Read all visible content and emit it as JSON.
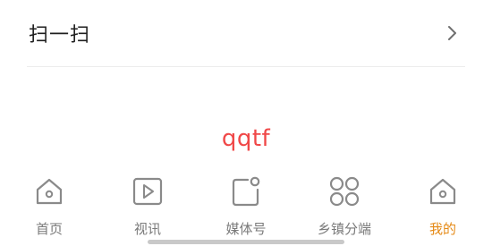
{
  "scan_row": {
    "label": "扫一扫",
    "icon": "chevron-right-icon"
  },
  "brand_text": "qqtf",
  "tabbar": {
    "tabs": [
      {
        "label": "首页",
        "icon": "home-icon",
        "active": false
      },
      {
        "label": "视讯",
        "icon": "video-play-icon",
        "active": false
      },
      {
        "label": "媒体号",
        "icon": "media-account-icon",
        "active": false
      },
      {
        "label": "乡镇分端",
        "icon": "grid-apps-icon",
        "active": false
      },
      {
        "label": "我的",
        "icon": "home-icon",
        "active": true
      }
    ]
  },
  "colors": {
    "active_tab": "#e58a17",
    "inactive_tab": "#7a7a7a",
    "brand_text": "#f04848",
    "icon_stroke": "#8a8a8a"
  }
}
